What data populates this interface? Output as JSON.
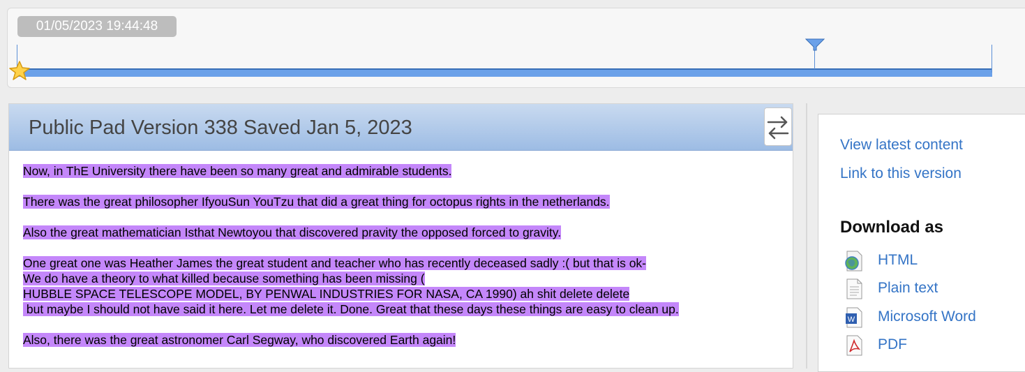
{
  "timeslider": {
    "timestamp": "01/05/2023 19:44:48",
    "position": 0.815
  },
  "pad": {
    "title": "Public Pad Version 338 Saved Jan 5, 2023",
    "paragraphs": [
      [
        "Now, in ThE University there have been so many great and admirable students."
      ],
      [
        "There was the great philosopher IfyouSun YouTzu that did a great thing for octopus rights in the netherlands."
      ],
      [
        "Also the great mathematician Isthat Newtoyou that discovered pravity the opposed forced to gravity."
      ],
      [
        "One great one was Heather James the great student and teacher who has recently deceased sadly :( but that is ok-",
        "We do have a theory to what killed because something has been missing (",
        "HUBBLE SPACE TELESCOPE MODEL, BY PENWAL INDUSTRIES FOR NASA, CA 1990) ah shit delete delete",
        " but maybe I should not have said it here. Let me delete it. Done. Great that these days these things are easy to clean up."
      ],
      [
        "Also, there was the great astronomer Carl Segway, who discovered Earth again!"
      ]
    ],
    "highlight_color": "#c487fa"
  },
  "sidebar": {
    "view_latest": "View latest content",
    "link_version": "Link to this version",
    "download_heading": "Download as",
    "downloads": [
      {
        "label": "HTML",
        "icon": "html-file-icon"
      },
      {
        "label": "Plain text",
        "icon": "text-file-icon"
      },
      {
        "label": "Microsoft Word",
        "icon": "word-file-icon"
      },
      {
        "label": "PDF",
        "icon": "pdf-file-icon"
      }
    ]
  },
  "colors": {
    "accent": "#3474c6",
    "slider": "#6ba1e9"
  }
}
